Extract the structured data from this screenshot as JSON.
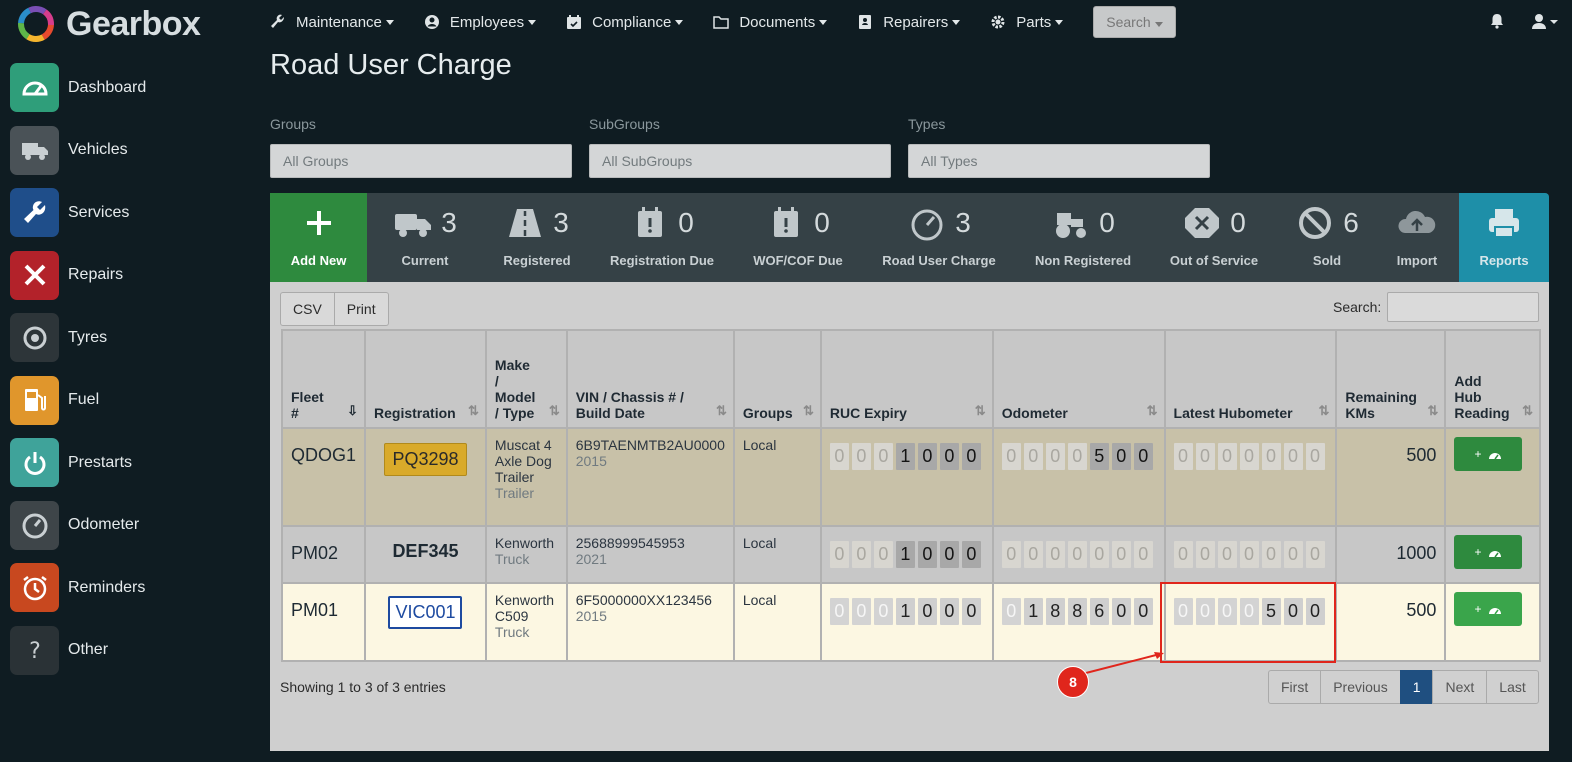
{
  "app": {
    "name": "Gearbox"
  },
  "topnav": {
    "items": [
      {
        "label": "Maintenance",
        "icon": "wrench-icon"
      },
      {
        "label": "Employees",
        "icon": "user-circle-icon"
      },
      {
        "label": "Compliance",
        "icon": "calendar-check-icon"
      },
      {
        "label": "Documents",
        "icon": "folder-icon"
      },
      {
        "label": "Repairers",
        "icon": "address-book-icon"
      },
      {
        "label": "Parts",
        "icon": "gear-icon"
      }
    ],
    "search_label": "Search"
  },
  "sidebar": {
    "items": [
      {
        "label": "Dashboard",
        "color": "#2f9e7a"
      },
      {
        "label": "Vehicles",
        "color": "#4a5257"
      },
      {
        "label": "Services",
        "color": "#1f4e8a"
      },
      {
        "label": "Repairs",
        "color": "#b3222a"
      },
      {
        "label": "Tyres",
        "color": "#2d3539"
      },
      {
        "label": "Fuel",
        "color": "#e0962c"
      },
      {
        "label": "Prestarts",
        "color": "#3fa39a"
      },
      {
        "label": "Odometer",
        "color": "#3e4549"
      },
      {
        "label": "Reminders",
        "color": "#c8481f"
      },
      {
        "label": "Other",
        "color": "#2a3236"
      }
    ]
  },
  "page": {
    "title": "Road User Charge"
  },
  "filters": {
    "groups_label": "Groups",
    "groups_value": "All Groups",
    "subgroups_label": "SubGroups",
    "subgroups_value": "All SubGroups",
    "types_label": "Types",
    "types_value": "All Types"
  },
  "stats": [
    {
      "label": "Add New",
      "num": ""
    },
    {
      "label": "Current",
      "num": "3"
    },
    {
      "label": "Registered",
      "num": "3"
    },
    {
      "label": "Registration Due",
      "num": "0"
    },
    {
      "label": "WOF/COF Due",
      "num": "0"
    },
    {
      "label": "Road User Charge",
      "num": "3"
    },
    {
      "label": "Non Registered",
      "num": "0"
    },
    {
      "label": "Out of Service",
      "num": "0"
    },
    {
      "label": "Sold",
      "num": "6"
    },
    {
      "label": "Import",
      "num": ""
    },
    {
      "label": "Reports",
      "num": ""
    }
  ],
  "toolbar": {
    "csv": "CSV",
    "print": "Print",
    "search_label": "Search:"
  },
  "table": {
    "headers": {
      "fleet_1": "Fleet",
      "fleet_2": "#",
      "registration": "Registration",
      "make_1": "Make",
      "make_2": "/",
      "make_3": "Model",
      "make_4": "/ Type",
      "vin_1": "VIN / Chassis # /",
      "vin_2": "Build Date",
      "groups": "Groups",
      "ruc": "RUC Expiry",
      "odometer": "Odometer",
      "hub": "Latest Hubometer",
      "rem_1": "Remaining",
      "rem_2": "KMs",
      "add_1": "Add",
      "add_2": "Hub",
      "add_3": "Reading"
    },
    "rows": [
      {
        "fleet": "QDOG1",
        "rego": "PQ3298",
        "make_1": "Muscat 4",
        "make_2": "Axle Dog",
        "make_3": "Trailer",
        "type": "Trailer",
        "vin": "6B9TAENMTB2AU0000",
        "year": "2015",
        "group": "Local",
        "ruc": "0001000",
        "odo": "0000500",
        "hub": "0000000",
        "remaining": "500",
        "add_label": "+"
      },
      {
        "fleet": "PM02",
        "rego": "DEF345",
        "make_1": "Kenworth",
        "make_2": "",
        "make_3": "",
        "type": "Truck",
        "vin": "25688999545953",
        "year": "2021",
        "group": "Local",
        "ruc": "0001000",
        "odo": "0000000",
        "hub": "0000000",
        "remaining": "1000",
        "add_label": "+"
      },
      {
        "fleet": "PM01",
        "rego": "VIC001",
        "make_1": "Kenworth",
        "make_2": "C509",
        "make_3": "",
        "type": "Truck",
        "vin": "6F5000000XX123456",
        "year": "2015",
        "group": "Local",
        "ruc": "0001000",
        "odo": "0188600",
        "hub": "0000500",
        "remaining": "500",
        "add_label": "+"
      }
    ]
  },
  "footer": {
    "showing": "Showing 1 to 3 of 3 entries",
    "pager": [
      "First",
      "Previous",
      "1",
      "Next",
      "Last"
    ]
  },
  "annotation": {
    "badge": "8"
  }
}
